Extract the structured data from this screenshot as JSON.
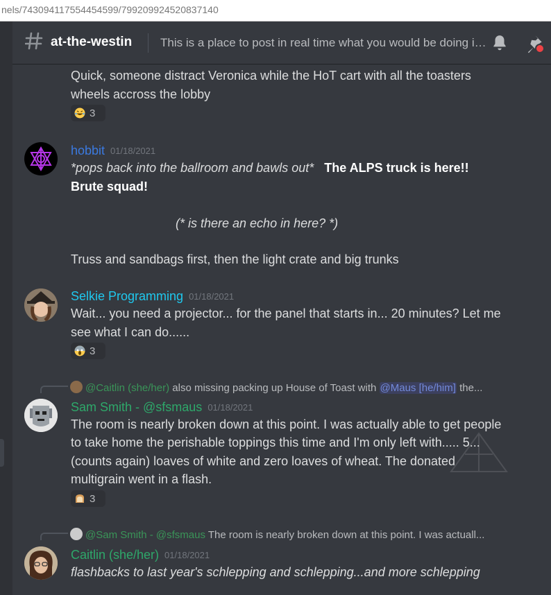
{
  "browser": {
    "url": "nels/743094117554454599/799209924520837140"
  },
  "header": {
    "channel_name": "at-the-westin",
    "topic": "This is a place to post in real time what you would be doing in the hotel right now if we were at Arisia"
  },
  "messages": [
    {
      "lines": [
        "Quick, someone distract Veronica while the HoT cart with all the toasters",
        "wheels accross the lobby"
      ],
      "reaction": {
        "emoji": "laughing-emoji",
        "count": "3"
      }
    },
    {
      "author": "hobbit",
      "author_color": "#3b7ae0",
      "timestamp": "01/18/2021",
      "line1_italic": "*pops back into the ballroom and bawls out*",
      "line1_bold": "The ALPS truck is here!!",
      "line2_bold": "Brute squad!",
      "echo": "(*  is there an echo in here?  *)",
      "line_last": "Truss and sandbags first, then the light crate and big trunks"
    },
    {
      "author": "Selkie Programming",
      "author_color": "#1fc8ee",
      "timestamp": "01/18/2021",
      "lines": [
        "Wait... you need a projector... for the panel that starts in... 20 minutes? Let me",
        "see what I can do......"
      ],
      "reaction": {
        "emoji": "scream-emoji",
        "count": "3"
      }
    },
    {
      "reply": {
        "mention": "@Caitlin (she/her)",
        "text": "also missing packing up House of Toast with",
        "mention2": "@Maus [he/him]",
        "tail": "the..."
      },
      "author": "Sam Smith - @sfsmaus",
      "author_color": "#2ea86a",
      "timestamp": "01/18/2021",
      "lines": [
        "The room is nearly broken down at this point. I was actually able to get people",
        "to take home the perishable toppings this time and I'm only left with..... 5...",
        "(counts again) loaves of white and zero loaves of wheat. The donated",
        "multigrain went in a flash."
      ],
      "reaction": {
        "emoji": "bread-emoji",
        "count": "3"
      }
    },
    {
      "reply": {
        "mention": "@Sam Smith - @sfsmaus",
        "text": "The room is nearly broken down at this point. I was actuall..."
      },
      "author": "Caitlin (she/her)",
      "author_color": "#2ea86a",
      "timestamp": "01/18/2021",
      "line_italic": "flashbacks to last year's schlepping and schlepping...and more schlepping"
    }
  ]
}
